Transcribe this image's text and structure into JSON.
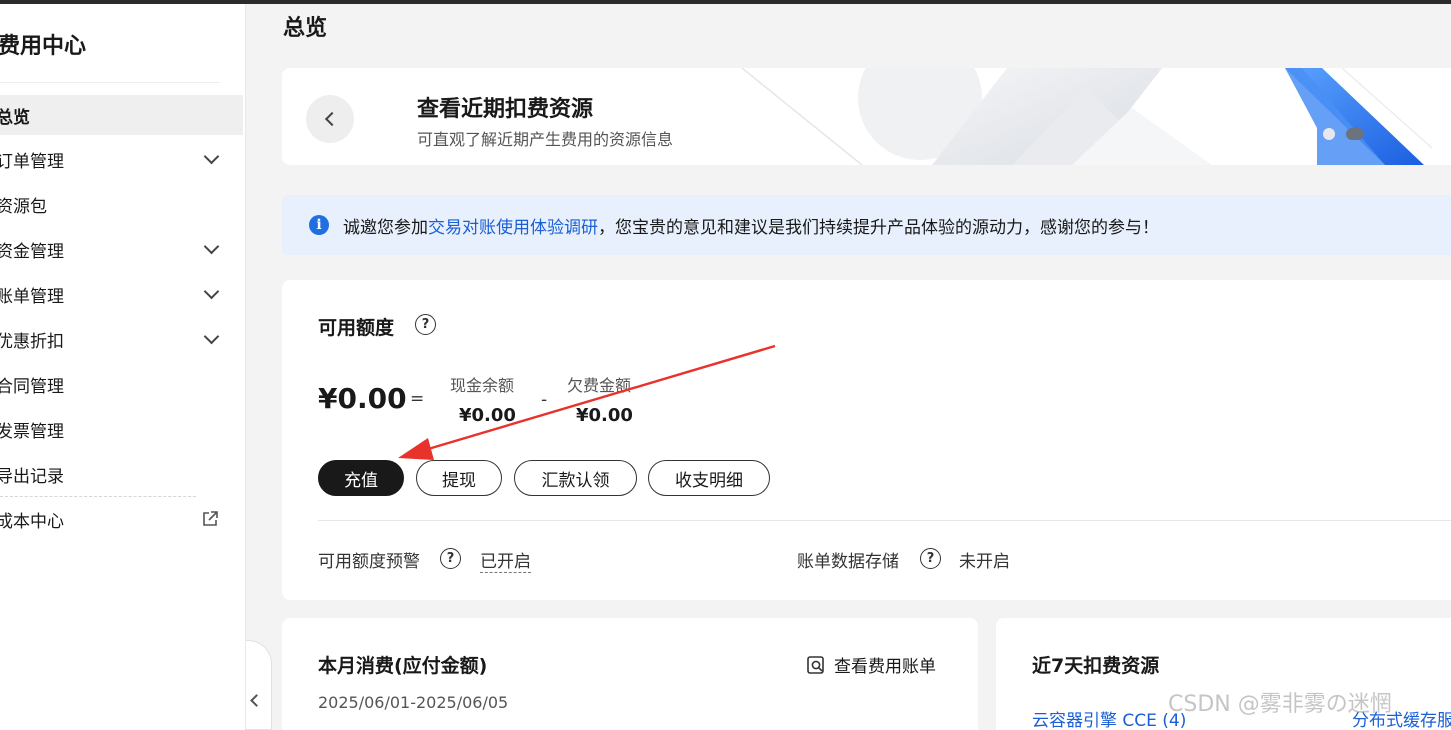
{
  "sidebar": {
    "title": "费用中心",
    "items": [
      {
        "label": "总览"
      },
      {
        "label": "订单管理"
      },
      {
        "label": "资源包"
      },
      {
        "label": "资金管理"
      },
      {
        "label": "账单管理"
      },
      {
        "label": "优惠折扣"
      },
      {
        "label": "合同管理"
      },
      {
        "label": "发票管理"
      },
      {
        "label": "导出记录"
      },
      {
        "label": "成本中心"
      }
    ]
  },
  "page": {
    "title": "总览"
  },
  "banner": {
    "title": "查看近期扣费资源",
    "subtitle": "可直观了解近期产生费用的资源信息"
  },
  "notice": {
    "prefix": "诚邀您参加",
    "link": "交易对账使用体验调研",
    "suffix": "，您宝贵的意见和建议是我们持续提升产品体验的源动力，感谢您的参与！"
  },
  "quota": {
    "title": "可用额度",
    "total": "¥0.00",
    "equals": "=",
    "minus": "-",
    "cash_label": "现金余额",
    "cash_value": "¥0.00",
    "debt_label": "欠费金额",
    "debt_value": "¥0.00",
    "buttons": {
      "recharge": "充值",
      "withdraw": "提现",
      "remit": "汇款认领",
      "detail": "收支明细"
    },
    "alert_label": "可用额度预警",
    "alert_value": "已开启",
    "storage_label": "账单数据存储",
    "storage_value": "未开启"
  },
  "month": {
    "title": "本月消费(应付金额)",
    "link": "查看费用账单",
    "date_range": "2025/06/01-2025/06/05"
  },
  "recent": {
    "title": "近7天扣费资源",
    "items": [
      "云容器引擎 CCE (4)",
      "分布式缓存服"
    ]
  },
  "watermark": "CSDN @雾非雾の迷惘",
  "colors": {
    "accent": "#1a5fd6",
    "primary_button": "#191919",
    "notice_bg": "#e7f0fc",
    "arrow": "#e8322b"
  }
}
